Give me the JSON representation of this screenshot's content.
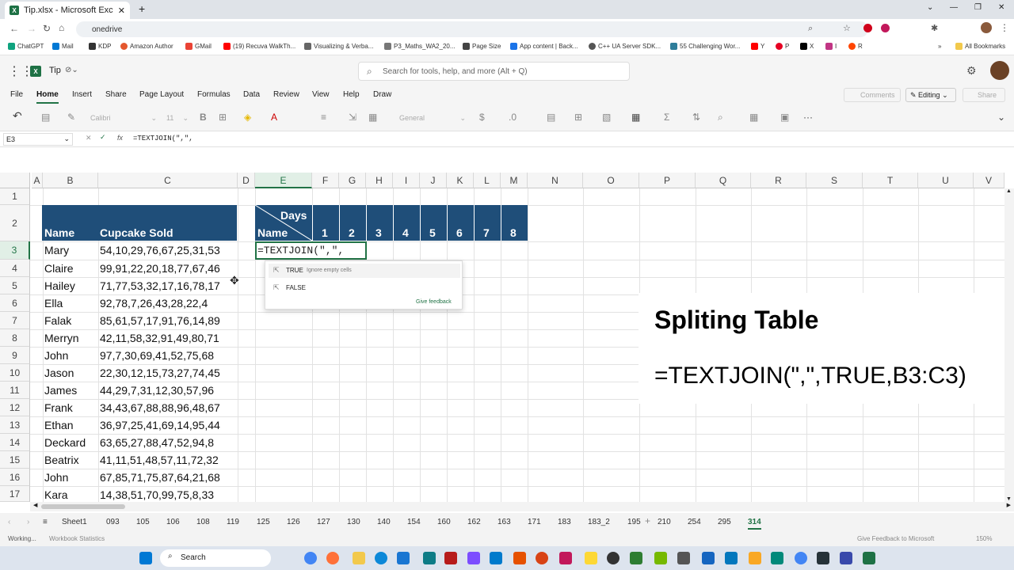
{
  "browser": {
    "tab_title": "Tip.xlsx - Microsoft Excel Online",
    "new_tab": "+",
    "address": "onedrive",
    "win_min": "⌄",
    "win_min2": "—",
    "win_max": "❐",
    "win_close": "✕",
    "bookmarks": [
      "ChatGPT",
      "Mail",
      "KDP",
      "Amazon Author",
      "GMail",
      "(19) Recuva WalkTh...",
      "Visualizing & Verba...",
      "P3_Maths_WA2_20...",
      "Page Size",
      "App content | Back...",
      "C++ UA Server SDK...",
      "55 Challenging Wor...",
      "Y",
      "P",
      "X",
      "I",
      "R"
    ],
    "all_bookmarks": "All Bookmarks"
  },
  "app": {
    "file_name": "Tip",
    "search_placeholder": "Search for tools, help, and more (Alt + Q)"
  },
  "menu": {
    "items": [
      "File",
      "Home",
      "Insert",
      "Share",
      "Page Layout",
      "Formulas",
      "Data",
      "Review",
      "View",
      "Help",
      "Draw"
    ],
    "active": "Home",
    "comments": "Comments",
    "editing": "Editing",
    "share": "Share"
  },
  "ribbon": {
    "font": "Calibri",
    "size": "11",
    "format": "General"
  },
  "formula_bar": {
    "cell_ref": "E3",
    "fx": "fx",
    "formula": "=TEXTJOIN(\",\","
  },
  "grid": {
    "columns": [
      "A",
      "B",
      "C",
      "D",
      "E",
      "F",
      "G",
      "H",
      "I",
      "J",
      "K",
      "L",
      "M",
      "N",
      "O",
      "P",
      "Q",
      "R",
      "S",
      "T",
      "U",
      "V"
    ],
    "rows": [
      "1",
      "2",
      "3",
      "4",
      "5",
      "6",
      "7",
      "8",
      "9",
      "10",
      "11",
      "12",
      "13",
      "14",
      "15",
      "16",
      "17"
    ],
    "header_name": "Name",
    "header_sold": "Cupcake Sold",
    "days_label": "Days",
    "days_name": "Name",
    "days": [
      "1",
      "2",
      "3",
      "4",
      "5",
      "6",
      "7",
      "8"
    ],
    "names": [
      "Mary",
      "Claire",
      "Hailey",
      "Ella",
      "Falak",
      "Merryn",
      "John",
      "Jason",
      "James",
      "Frank",
      "Ethan",
      "Deckard",
      "Beatrix",
      "John",
      "Kara"
    ],
    "sold": [
      "54,10,29,76,67,25,31,53",
      "99,91,22,20,18,77,67,46",
      "71,77,53,32,17,16,78,17",
      "92,78,7,26,43,28,22,4",
      "85,61,57,17,91,76,14,89",
      "42,11,58,32,91,49,80,71",
      "97,7,30,69,41,52,75,68",
      "22,30,12,15,73,27,74,45",
      "44,29,7,31,12,30,57,96",
      "34,43,67,88,88,96,48,67",
      "36,97,25,41,69,14,95,44",
      "63,65,27,88,47,52,94,8",
      "41,11,51,48,57,11,72,32",
      "67,85,71,75,87,64,21,68",
      "14,38,51,70,99,75,8,33"
    ],
    "editing_cell": "=TEXTJOIN(\",\","
  },
  "autocomplete": {
    "true_label": "TRUE",
    "true_hint": "Ignore empty cells",
    "false_label": "FALSE",
    "feedback": "Give feedback"
  },
  "overlay": {
    "title": "Spliting Table",
    "formula": "=TEXTJOIN(\",\",TRUE,B3:C3)"
  },
  "sheets": {
    "tabs": [
      "Sheet1",
      "093",
      "105",
      "106",
      "108",
      "119",
      "125",
      "126",
      "127",
      "130",
      "140",
      "154",
      "160",
      "162",
      "163",
      "171",
      "183",
      "183_2",
      "195",
      "210",
      "254",
      "295",
      "314"
    ],
    "active": "314",
    "add": "+"
  },
  "status": {
    "left": "Working...",
    "stats": "Workbook Statistics",
    "feedback": "Give Feedback to Microsoft",
    "zoom": "150%"
  },
  "taskbar": {
    "search": "Search"
  },
  "colors": {
    "header_bg": "#1f4e79",
    "accent": "#217346"
  }
}
